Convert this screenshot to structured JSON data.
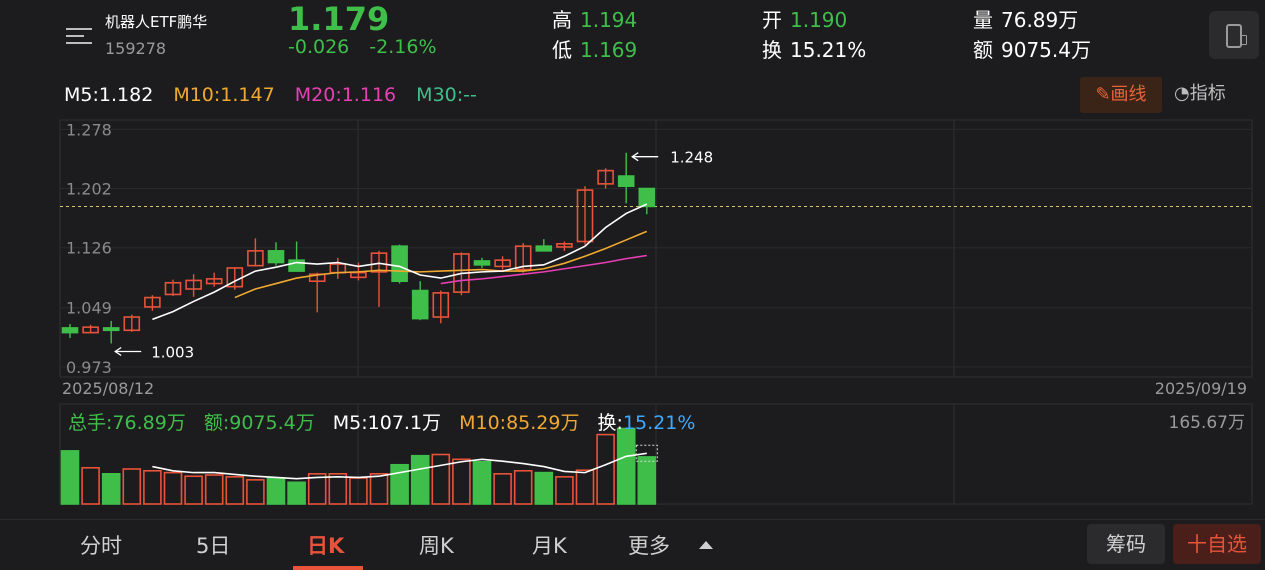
{
  "header": {
    "name": "机器人ETF鹏华",
    "code": "159278",
    "price": "1.179",
    "change": "-0.026",
    "change_pct": "-2.16%",
    "high_label": "高",
    "high": "1.194",
    "low_label": "低",
    "low": "1.169",
    "open_label": "开",
    "open": "1.190",
    "turnover_label": "换",
    "turnover": "15.21%",
    "volume_label": "量",
    "volume": "76.89万",
    "amount_label": "额",
    "amount": "9075.4万"
  },
  "ma_bar": {
    "m5": "M5:1.182",
    "m10": "M10:1.147",
    "m20": "M20:1.116",
    "m30": "M30:--"
  },
  "toolbar": {
    "draw_label": "画线",
    "indicator_label": "指标"
  },
  "colors": {
    "up": "#e8533a",
    "down": "#3fbf4a",
    "m5": "#ffffff",
    "m10": "#f0a830",
    "m20": "#e83fb4",
    "m30": "#3fbf8a"
  },
  "chart_data": {
    "type": "candlestick",
    "ylim": [
      0.96,
      1.29
    ],
    "ytick_labels": [
      "1.278",
      "1.202",
      "1.126",
      "1.049",
      "0.973"
    ],
    "yticks": [
      1.278,
      1.202,
      1.126,
      1.049,
      0.973
    ],
    "x_start_label": "2025/08/12",
    "x_end_label": "2025/09/19",
    "high_annotation": "1.248",
    "low_annotation": "1.003",
    "last_price": 1.179,
    "candles": [
      {
        "o": 1.023,
        "h": 1.028,
        "l": 1.01,
        "c": 1.017
      },
      {
        "o": 1.017,
        "h": 1.027,
        "l": 1.016,
        "c": 1.024
      },
      {
        "o": 1.023,
        "h": 1.032,
        "l": 1.003,
        "c": 1.02
      },
      {
        "o": 1.02,
        "h": 1.04,
        "l": 1.018,
        "c": 1.037
      },
      {
        "o": 1.05,
        "h": 1.065,
        "l": 1.045,
        "c": 1.062
      },
      {
        "o": 1.066,
        "h": 1.085,
        "l": 1.064,
        "c": 1.081
      },
      {
        "o": 1.073,
        "h": 1.092,
        "l": 1.063,
        "c": 1.084
      },
      {
        "o": 1.08,
        "h": 1.094,
        "l": 1.076,
        "c": 1.086
      },
      {
        "o": 1.076,
        "h": 1.101,
        "l": 1.072,
        "c": 1.1
      },
      {
        "o": 1.103,
        "h": 1.138,
        "l": 1.102,
        "c": 1.122
      },
      {
        "o": 1.122,
        "h": 1.133,
        "l": 1.103,
        "c": 1.107
      },
      {
        "o": 1.11,
        "h": 1.134,
        "l": 1.099,
        "c": 1.096
      },
      {
        "o": 1.083,
        "h": 1.094,
        "l": 1.043,
        "c": 1.092
      },
      {
        "o": 1.094,
        "h": 1.113,
        "l": 1.086,
        "c": 1.105
      },
      {
        "o": 1.088,
        "h": 1.107,
        "l": 1.084,
        "c": 1.094
      },
      {
        "o": 1.095,
        "h": 1.122,
        "l": 1.05,
        "c": 1.119
      },
      {
        "o": 1.128,
        "h": 1.13,
        "l": 1.08,
        "c": 1.083
      },
      {
        "o": 1.071,
        "h": 1.083,
        "l": 1.033,
        "c": 1.035
      },
      {
        "o": 1.037,
        "h": 1.071,
        "l": 1.029,
        "c": 1.068
      },
      {
        "o": 1.069,
        "h": 1.12,
        "l": 1.065,
        "c": 1.118
      },
      {
        "o": 1.109,
        "h": 1.113,
        "l": 1.1,
        "c": 1.104
      },
      {
        "o": 1.102,
        "h": 1.115,
        "l": 1.098,
        "c": 1.11
      },
      {
        "o": 1.098,
        "h": 1.132,
        "l": 1.094,
        "c": 1.128
      },
      {
        "o": 1.128,
        "h": 1.137,
        "l": 1.124,
        "c": 1.122
      },
      {
        "o": 1.127,
        "h": 1.134,
        "l": 1.122,
        "c": 1.131
      },
      {
        "o": 1.134,
        "h": 1.205,
        "l": 1.13,
        "c": 1.2
      },
      {
        "o": 1.208,
        "h": 1.228,
        "l": 1.202,
        "c": 1.225
      },
      {
        "o": 1.218,
        "h": 1.248,
        "l": 1.183,
        "c": 1.205
      },
      {
        "o": 1.202,
        "h": 1.194,
        "l": 1.169,
        "c": 1.179
      }
    ],
    "ma5": [
      null,
      null,
      null,
      null,
      1.034,
      1.044,
      1.057,
      1.069,
      1.083,
      1.096,
      1.101,
      1.107,
      1.105,
      1.107,
      1.102,
      1.106,
      1.102,
      1.091,
      1.087,
      1.093,
      1.095,
      1.096,
      1.102,
      1.104,
      1.115,
      1.128,
      1.152,
      1.17,
      1.182
    ],
    "ma10": [
      null,
      null,
      null,
      null,
      null,
      null,
      null,
      null,
      1.062,
      1.073,
      1.08,
      1.087,
      1.091,
      1.094,
      1.095,
      1.097,
      1.096,
      1.095,
      1.096,
      1.097,
      1.098,
      1.096,
      1.096,
      1.099,
      1.106,
      1.115,
      1.125,
      1.136,
      1.147
    ],
    "ma20": [
      null,
      null,
      null,
      null,
      null,
      null,
      null,
      null,
      null,
      null,
      null,
      null,
      null,
      null,
      null,
      null,
      null,
      null,
      1.08,
      1.084,
      1.086,
      1.089,
      1.092,
      1.095,
      1.099,
      1.103,
      1.107,
      1.112,
      1.116
    ],
    "volume": {
      "info_total": "总手:76.89万",
      "info_amount": "额:9075.4万",
      "info_m5": "M5:107.1万",
      "info_m10": "M10:85.29万",
      "info_turnover_label": "换:",
      "info_turnover": "15.21%",
      "max_label": "165.67万",
      "max": 165.67,
      "values": [
        88,
        60,
        50,
        58,
        55,
        52,
        46,
        48,
        45,
        40,
        43,
        36,
        50,
        50,
        43,
        50,
        65,
        80,
        82,
        74,
        70,
        50,
        55,
        52,
        45,
        56,
        115,
        125,
        78
      ],
      "ma5": [
        null,
        null,
        null,
        null,
        62,
        55,
        52,
        52,
        49,
        46,
        44,
        42,
        44,
        45,
        44,
        46,
        52,
        58,
        64,
        70,
        74,
        71,
        67,
        62,
        54,
        52,
        65,
        79,
        84
      ]
    }
  },
  "tabs": [
    "分时",
    "5日",
    "日K",
    "周K",
    "月K",
    "更多"
  ],
  "active_tab": "日K",
  "footer": {
    "chips_label": "筹码",
    "watch_label": "十自选"
  }
}
